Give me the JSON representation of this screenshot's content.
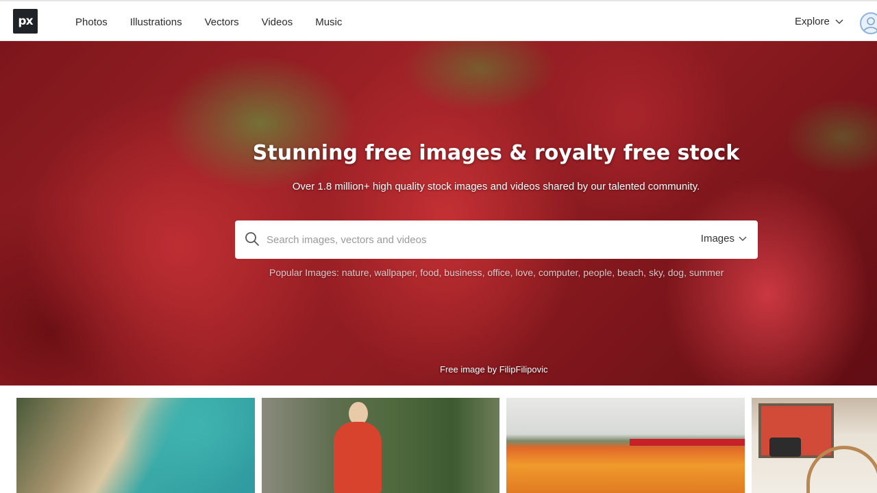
{
  "nav": {
    "logo_text": "px",
    "links": [
      "Photos",
      "Illustrations",
      "Vectors",
      "Videos",
      "Music"
    ],
    "explore_label": "Explore"
  },
  "hero": {
    "title": "Stunning free images & royalty free stock",
    "subtitle": "Over 1.8 million+ high quality stock images and videos shared by our talented community.",
    "search_placeholder": "Search images, vectors and videos",
    "search_type": "Images",
    "popular_prefix": "Popular Images:",
    "popular_tags": [
      "nature",
      "wallpaper",
      "food",
      "business",
      "office",
      "love",
      "computer",
      "people",
      "beach",
      "sky",
      "dog",
      "summer"
    ],
    "credit": "Free image by FilipFilipovic"
  },
  "colors": {
    "logo_bg": "#1f2226",
    "hero_red": "#c1272d",
    "nav_text": "#2b2b2b"
  },
  "icons": {
    "search": "search-icon",
    "explore_chevron": "chevron-down-icon",
    "type_chevron": "chevron-down-icon",
    "avatar": "user-avatar-icon"
  }
}
